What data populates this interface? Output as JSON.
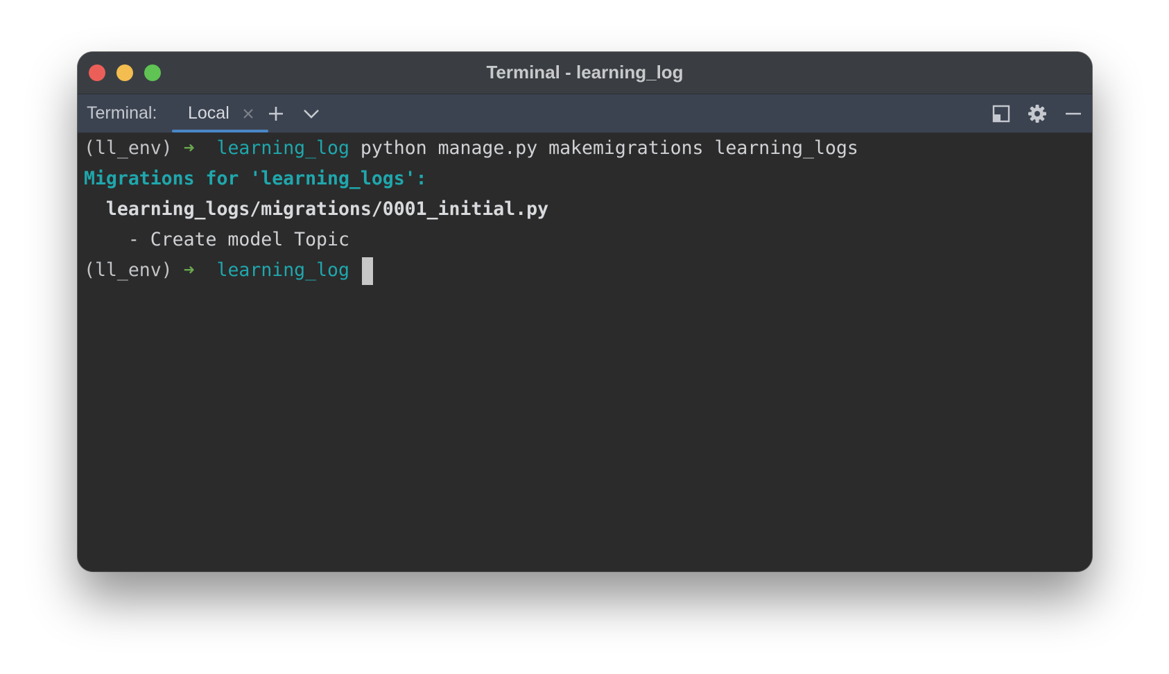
{
  "window": {
    "title": "Terminal - learning_log"
  },
  "toolbar": {
    "label": "Terminal:",
    "tab_label": "Local"
  },
  "terminal": {
    "lines": [
      {
        "env": "(ll_env)",
        "arrow": "➜",
        "dir": "learning_log",
        "cmd": "python manage.py makemigrations learning_logs"
      },
      {
        "text": "Migrations for 'learning_logs':"
      },
      {
        "text": "  learning_logs/migrations/0001_initial.py"
      },
      {
        "text": "    - Create model Topic"
      },
      {
        "env": "(ll_env)",
        "arrow": "➜",
        "dir": "learning_log",
        "cmd": ""
      }
    ]
  },
  "colors": {
    "titlebar": "#3a3e43",
    "toolbar": "#3c4350",
    "background": "#2b2b2b",
    "accent": "#4a88c7",
    "prompt_dir": "#1fa7ad",
    "prompt_arrow": "#6aa84f"
  }
}
